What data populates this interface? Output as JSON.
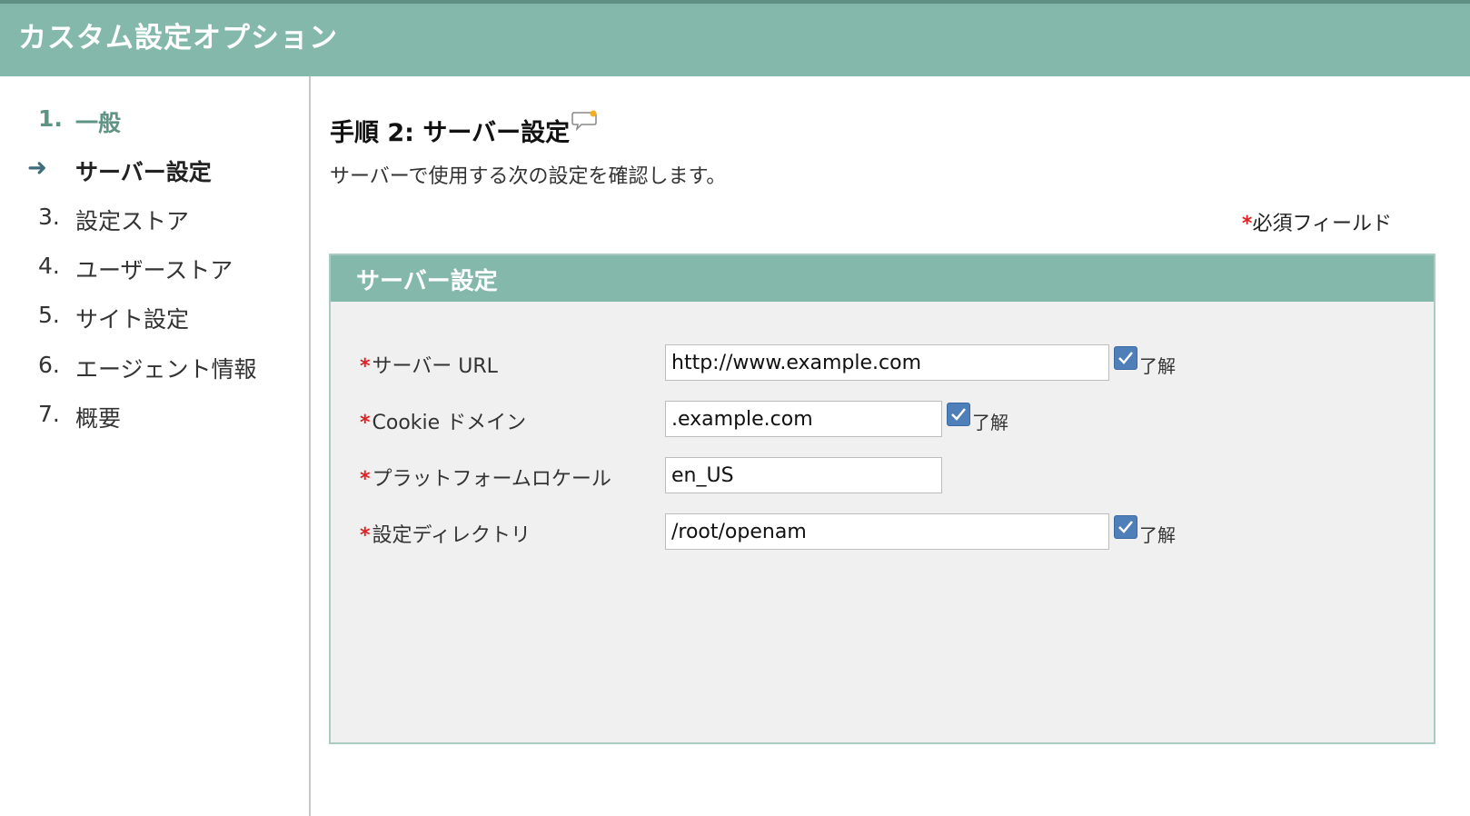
{
  "header": {
    "title": "カスタム設定オプション"
  },
  "sidebar": {
    "steps": [
      {
        "num": "1.",
        "label": "一般"
      },
      {
        "num": "",
        "label": "サーバー設定"
      },
      {
        "num": "3.",
        "label": "設定ストア"
      },
      {
        "num": "4.",
        "label": "ユーザーストア"
      },
      {
        "num": "5.",
        "label": "サイト設定"
      },
      {
        "num": "6.",
        "label": "エージェント情報"
      },
      {
        "num": "7.",
        "label": "概要"
      }
    ]
  },
  "main": {
    "step_title": "手順 2: サーバー設定",
    "description": "サーバーで使用する次の設定を確認します。",
    "required_star": "*",
    "required_note": "必須フィールド",
    "panel_title": "サーバー設定",
    "fields": [
      {
        "label": "サーバー URL",
        "value": "http://www.example.com",
        "checked": true,
        "ack": "了解"
      },
      {
        "label": "Cookie ドメイン",
        "value": ".example.com",
        "checked": true,
        "ack": "了解"
      },
      {
        "label": "プラットフォームロケール",
        "value": "en_US",
        "checked": false,
        "ack": ""
      },
      {
        "label": "設定ディレクトリ",
        "value": "/root/openam",
        "checked": true,
        "ack": "了解"
      }
    ]
  },
  "colors": {
    "header_bg": "#83b8aa",
    "panel_bg": "#f0f0f0",
    "checkbox": "#4f7fb8",
    "required": "#dd2222"
  },
  "icons": {
    "current_step": "arrow-right-icon",
    "help": "speech-bubble-icon",
    "checkbox": "checkmark-icon"
  }
}
